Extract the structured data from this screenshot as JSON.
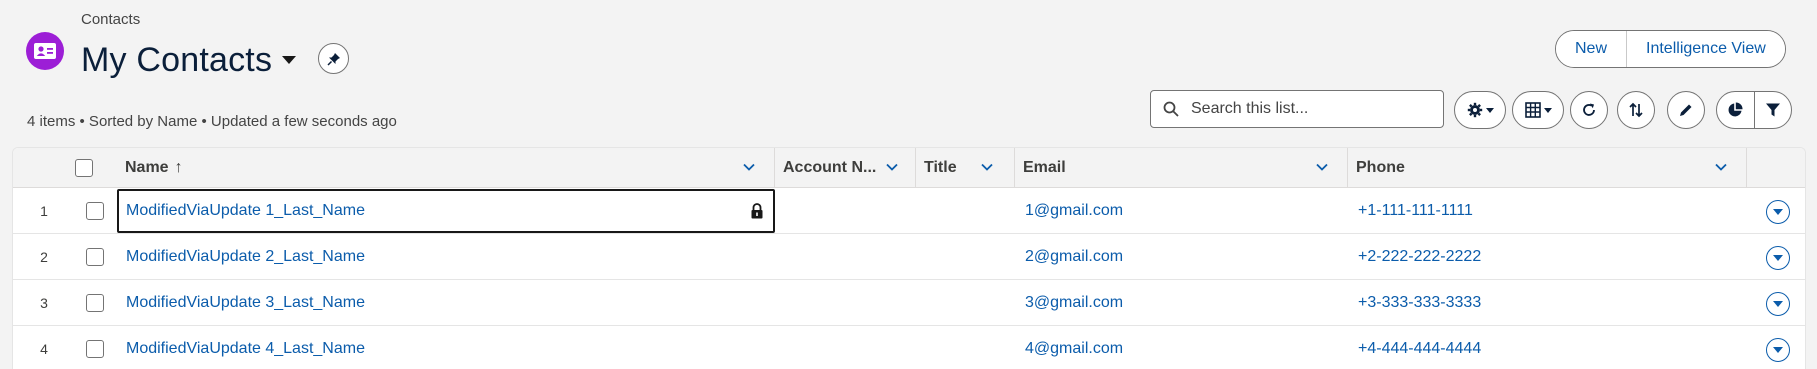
{
  "header": {
    "breadcrumb": "Contacts",
    "title": "My Contacts",
    "meta": "4 items • Sorted by Name • Updated a few seconds ago",
    "buttons": {
      "new": "New",
      "intelligence_view": "Intelligence View"
    }
  },
  "search": {
    "placeholder": "Search this list...",
    "value": ""
  },
  "toolbar_icons": [
    "settings-gear-icon",
    "table-view-icon",
    "refresh-icon",
    "sort-icon",
    "edit-pencil-icon",
    "chart-icon",
    "filter-icon"
  ],
  "table": {
    "columns": {
      "name": "Name",
      "sort_indicator": "↑",
      "account_name": "Account N...",
      "title": "Title",
      "email": "Email",
      "phone": "Phone"
    },
    "rows": [
      {
        "num": "1",
        "name": "ModifiedViaUpdate 1_Last_Name",
        "account": "",
        "title": "",
        "email": "1@gmail.com",
        "phone": "+1-111-111-1111"
      },
      {
        "num": "2",
        "name": "ModifiedViaUpdate 2_Last_Name",
        "account": "",
        "title": "",
        "email": "2@gmail.com",
        "phone": "+2-222-222-2222"
      },
      {
        "num": "3",
        "name": "ModifiedViaUpdate 3_Last_Name",
        "account": "",
        "title": "",
        "email": "3@gmail.com",
        "phone": "+3-333-333-3333"
      },
      {
        "num": "4",
        "name": "ModifiedViaUpdate 4_Last_Name",
        "account": "",
        "title": "",
        "email": "4@gmail.com",
        "phone": "+4-444-444-4444"
      }
    ]
  },
  "colors": {
    "brand_icon": "#9c1ed6",
    "link": "#0b5cab",
    "title": "#0b1f3a"
  }
}
